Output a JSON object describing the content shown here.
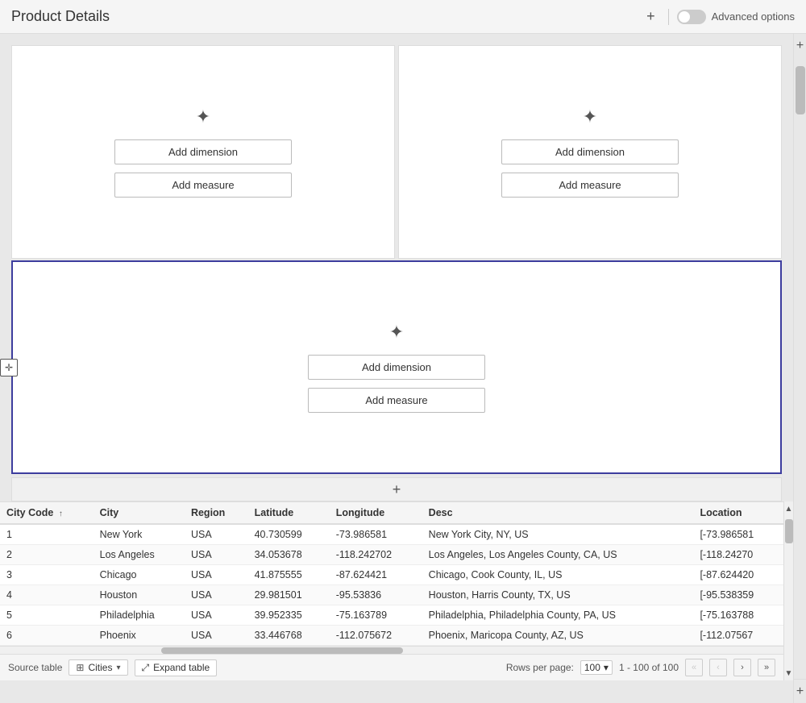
{
  "header": {
    "title": "Product Details",
    "plus_label": "+",
    "advanced_options_label": "Advanced options"
  },
  "panels": {
    "panel1": {
      "magic_icon": "✦",
      "add_dimension_label": "Add dimension",
      "add_measure_label": "Add measure"
    },
    "panel2": {
      "magic_icon": "✦",
      "add_dimension_label": "Add dimension",
      "add_measure_label": "Add measure"
    },
    "panel3": {
      "magic_icon": "✦",
      "add_dimension_label": "Add dimension",
      "add_measure_label": "Add measure"
    }
  },
  "table": {
    "grid_icon": "⊞",
    "columns": [
      "City Code",
      "City",
      "Region",
      "Latitude",
      "Longitude",
      "Desc",
      "Location"
    ],
    "sort_col": "City Code",
    "sort_dir": "↑",
    "rows": [
      {
        "city_code": "1",
        "city": "New York",
        "region": "USA",
        "latitude": "40.730599",
        "longitude": "-73.986581",
        "desc": "New York City, NY, US",
        "location": "[-73.986581"
      },
      {
        "city_code": "2",
        "city": "Los Angeles",
        "region": "USA",
        "latitude": "34.053678",
        "longitude": "-118.242702",
        "desc": "Los Angeles, Los Angeles County, CA, US",
        "location": "[-118.24270"
      },
      {
        "city_code": "3",
        "city": "Chicago",
        "region": "USA",
        "latitude": "41.875555",
        "longitude": "-87.624421",
        "desc": "Chicago, Cook County, IL, US",
        "location": "[-87.624420"
      },
      {
        "city_code": "4",
        "city": "Houston",
        "region": "USA",
        "latitude": "29.981501",
        "longitude": "-95.53836",
        "desc": "Houston, Harris County, TX, US",
        "location": "[-95.538359"
      },
      {
        "city_code": "5",
        "city": "Philadelphia",
        "region": "USA",
        "latitude": "39.952335",
        "longitude": "-75.163789",
        "desc": "Philadelphia, Philadelphia County, PA, US",
        "location": "[-75.163788"
      },
      {
        "city_code": "6",
        "city": "Phoenix",
        "region": "USA",
        "latitude": "33.446768",
        "longitude": "-112.075672",
        "desc": "Phoenix, Maricopa County, AZ, US",
        "location": "[-112.07567"
      }
    ]
  },
  "footer": {
    "source_label": "Source table",
    "table_icon": "⊞",
    "table_name": "Cities",
    "expand_icon": "⤢",
    "expand_label": "Expand table",
    "rows_per_page_label": "Rows per page:",
    "rows_per_page_value": "100",
    "page_info": "1 - 100 of 100",
    "nav_first": "«",
    "nav_prev": "‹",
    "nav_next": "›",
    "nav_last": "»"
  }
}
